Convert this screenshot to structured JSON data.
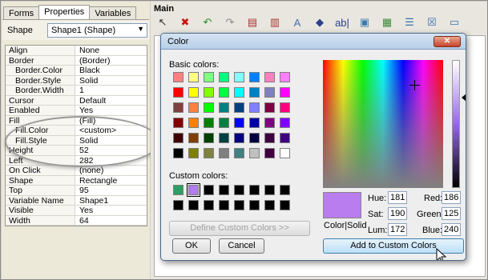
{
  "tabs": [
    "Forms",
    "Properties",
    "Variables"
  ],
  "shape_selector": {
    "label": "Shape",
    "value": "Shape1 (Shape)"
  },
  "properties": [
    {
      "name": "Align",
      "value": "None",
      "sub": false
    },
    {
      "name": "Border",
      "value": "(Border)",
      "sub": false
    },
    {
      "name": "Border.Color",
      "value": "Black",
      "sub": true
    },
    {
      "name": "Border.Style",
      "value": "Solid",
      "sub": true
    },
    {
      "name": "Border.Width",
      "value": "1",
      "sub": true
    },
    {
      "name": "Cursor",
      "value": "Default",
      "sub": false
    },
    {
      "name": "Enabled",
      "value": "Yes",
      "sub": false
    },
    {
      "name": "Fill",
      "value": "(Fill)",
      "sub": false
    },
    {
      "name": "Fill.Color",
      "value": "<custom>",
      "sub": true
    },
    {
      "name": "Fill.Style",
      "value": "Solid",
      "sub": true
    },
    {
      "name": "Height",
      "value": "52",
      "sub": false
    },
    {
      "name": "Left",
      "value": "282",
      "sub": false
    },
    {
      "name": "On Click",
      "value": "(none)",
      "sub": false
    },
    {
      "name": "Shape",
      "value": "Rectangle",
      "sub": false
    },
    {
      "name": "Top",
      "value": "95",
      "sub": false
    },
    {
      "name": "Variable Name",
      "value": "Shape1",
      "sub": false
    },
    {
      "name": "Visible",
      "value": "Yes",
      "sub": false
    },
    {
      "name": "Width",
      "value": "64",
      "sub": false
    }
  ],
  "main": {
    "title": "Main",
    "toolbar": [
      {
        "icon": "pointer-icon",
        "glyph": "↖",
        "color": "#333333"
      },
      {
        "icon": "delete-icon",
        "glyph": "✖",
        "color": "#cc1111"
      },
      {
        "icon": "undo-icon",
        "glyph": "↶",
        "color": "#2f8a2f"
      },
      {
        "icon": "redo-icon",
        "glyph": "↷",
        "color": "#8a8a8a"
      },
      {
        "icon": "add-form-icon",
        "glyph": "▤",
        "color": "#aa3333"
      },
      {
        "icon": "remove-form-icon",
        "glyph": "▥",
        "color": "#aa3333"
      },
      {
        "icon": "text-icon",
        "glyph": "A",
        "color": "#4a6fb0"
      },
      {
        "icon": "shapes-icon",
        "glyph": "◆",
        "color": "#2b3f8a"
      },
      {
        "icon": "textbox-icon",
        "glyph": "ab|",
        "color": "#2b3f8a"
      },
      {
        "icon": "image-icon",
        "glyph": "▣",
        "color": "#3a7ab0"
      },
      {
        "icon": "picture-icon",
        "glyph": "▦",
        "color": "#3a8a3a"
      },
      {
        "icon": "list-icon",
        "glyph": "☰",
        "color": "#3a6fb0"
      },
      {
        "icon": "checkbox-icon",
        "glyph": "☒",
        "color": "#3a6fb0"
      },
      {
        "icon": "combo-icon",
        "glyph": "▭",
        "color": "#3a6fb0"
      }
    ]
  },
  "color_dialog": {
    "title": "Color",
    "close_glyph": "✕",
    "basic_colors_label": "Basic colors:",
    "basic_colors": [
      "#ff8080",
      "#ffff80",
      "#80ff80",
      "#00ff80",
      "#80ffff",
      "#0080ff",
      "#ff80c0",
      "#ff80ff",
      "#ff0000",
      "#ffff00",
      "#80ff00",
      "#00ff40",
      "#00ffff",
      "#0080c0",
      "#8080c0",
      "#ff00ff",
      "#804040",
      "#ff8040",
      "#00ff00",
      "#008080",
      "#004080",
      "#8080ff",
      "#800040",
      "#ff0080",
      "#800000",
      "#ff8000",
      "#008000",
      "#008040",
      "#0000ff",
      "#0000a0",
      "#800080",
      "#8000ff",
      "#400000",
      "#804000",
      "#004000",
      "#004040",
      "#000080",
      "#000040",
      "#400040",
      "#400080",
      "#000000",
      "#808000",
      "#808040",
      "#808080",
      "#408080",
      "#c0c0c0",
      "#400040",
      "#ffffff"
    ],
    "custom_colors_label": "Custom colors:",
    "custom_colors": [
      "#2e9e62",
      "#b07cf0",
      "#000000",
      "#000000",
      "#000000",
      "#000000",
      "#000000",
      "#000000",
      "#000000",
      "#000000",
      "#000000",
      "#000000",
      "#000000",
      "#000000",
      "#000000",
      "#000000"
    ],
    "define_button": "Define Custom Colors >>",
    "ok_button": "OK",
    "cancel_button": "Cancel",
    "preview_label": "Color|Solid",
    "selected_color": "#ba7df0",
    "hue_label": "Hue:",
    "hue": "181",
    "sat_label": "Sat:",
    "sat": "190",
    "lum_label": "Lum:",
    "lum": "172",
    "red_label": "Red:",
    "red": "186",
    "green_label": "Green:",
    "green": "125",
    "blue_label": "Blue:",
    "blue": "240",
    "add_button": "Add to Custom Colors"
  }
}
